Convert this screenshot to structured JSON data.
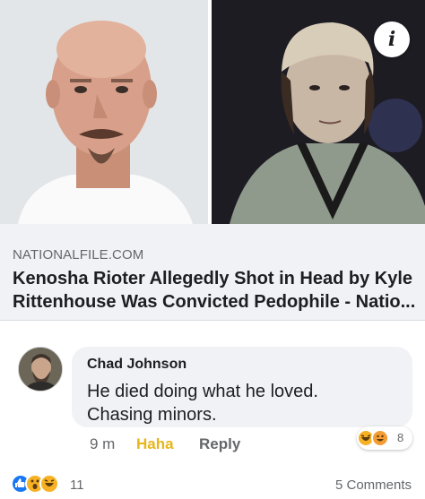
{
  "link_preview": {
    "domain": "NATIONALFILE.COM",
    "title_line1": "Kenosha Rioter Allegedly Shot in Head by Kyle",
    "title_line2": "Rittenhouse Was Convicted Pedophile - Natio...",
    "info_icon": "i"
  },
  "comment": {
    "author": "Chad Johnson",
    "text_line1": "He died doing what he loved.",
    "text_line2": "Chasing minors.",
    "time": "9 m",
    "haha_label": "Haha",
    "reply_label": "Reply",
    "reaction_count": "8",
    "reaction_icons": [
      "haha-emoji-icon",
      "laughing-emoji-icon"
    ]
  },
  "post_footer": {
    "reaction_icons": [
      "like-reaction-icon",
      "wow-reaction-icon",
      "haha-reaction-icon"
    ],
    "reaction_count": "11",
    "comments_label": "5 Comments"
  },
  "colors": {
    "link_box_bg": "#f0f2f5",
    "haha_yellow": "#e7b61a",
    "like_blue": "#1877f2",
    "secondary_text": "#65676b"
  }
}
